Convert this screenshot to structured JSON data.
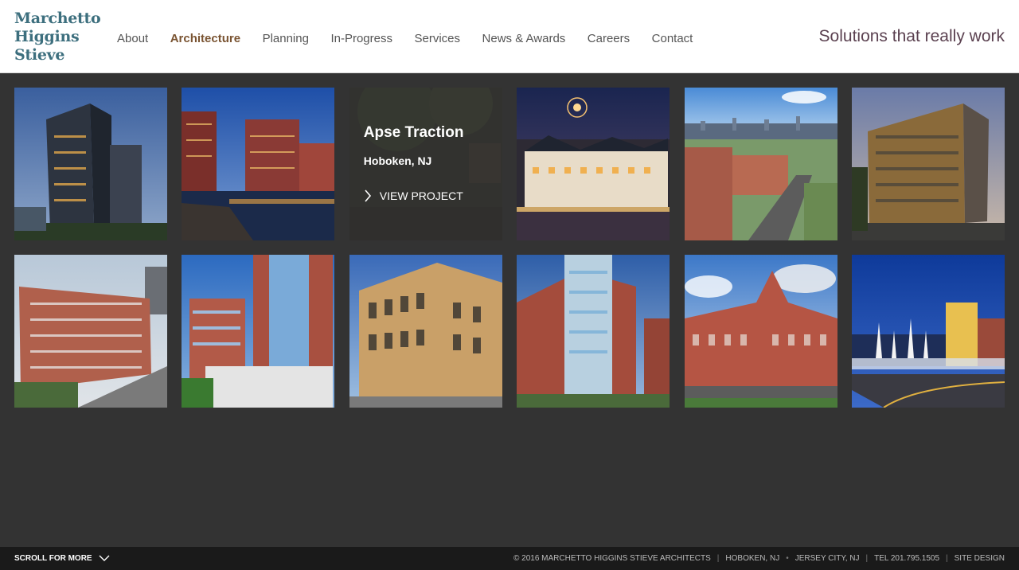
{
  "logo": {
    "line1": "Marchetto",
    "line2": "Higgins",
    "line3": "Stieve"
  },
  "nav": [
    {
      "label": "About",
      "active": false
    },
    {
      "label": "Architecture",
      "active": true
    },
    {
      "label": "Planning",
      "active": false
    },
    {
      "label": "In-Progress",
      "active": false
    },
    {
      "label": "Services",
      "active": false
    },
    {
      "label": "News & Awards",
      "active": false
    },
    {
      "label": "Careers",
      "active": false
    },
    {
      "label": "Contact",
      "active": false
    }
  ],
  "tagline": "Solutions that really work",
  "hover_project": {
    "title": "Apse Traction",
    "location": "Hoboken, NJ",
    "link_label": "VIEW PROJECT"
  },
  "footer": {
    "scroll_label": "SCROLL FOR MORE",
    "copyright": "© 2016 MARCHETTO HIGGINS STIEVE ARCHITECTS",
    "sep1": "|",
    "city1": "HOBOKEN, NJ",
    "dot": "•",
    "city2": "JERSEY CITY, NJ",
    "sep2": "|",
    "tel": "TEL 201.795.1505",
    "sep3": "|",
    "site_design": "SITE DESIGN"
  },
  "colors": {
    "logo": "#3d6f7e",
    "active_nav": "#7a5432",
    "tagline": "#5b4150",
    "background": "#333333"
  }
}
